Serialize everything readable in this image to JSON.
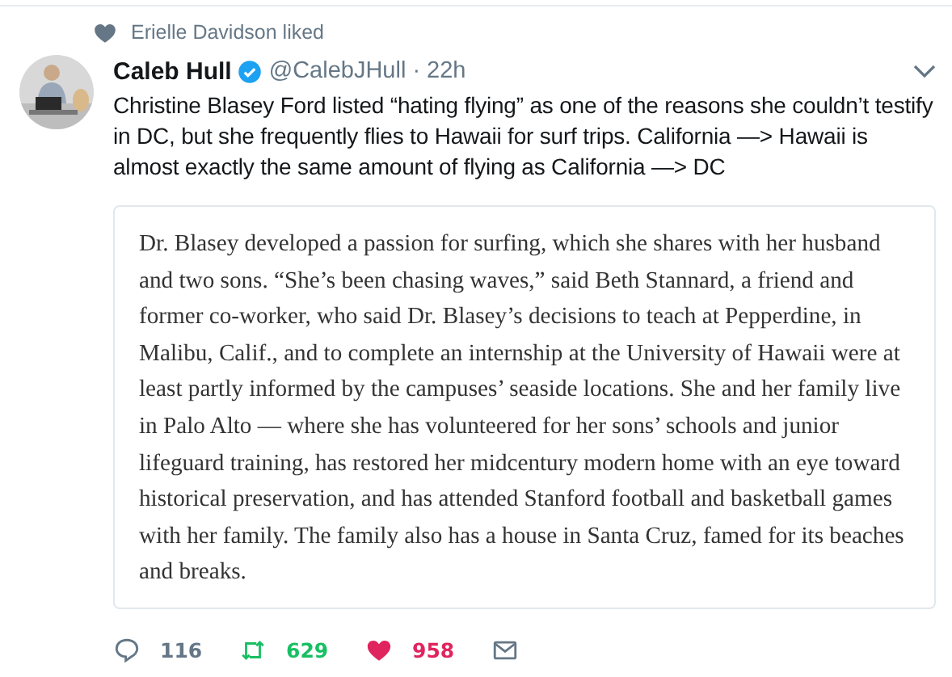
{
  "social_context": {
    "text": "Erielle Davidson liked"
  },
  "tweet": {
    "author": {
      "name": "Caleb Hull",
      "verified": true,
      "handle": "@CalebJHull",
      "separator": "·",
      "time": "22h"
    },
    "text": "Christine Blasey Ford listed “hating flying” as one of the reasons she couldn’t testify in DC, but she frequently flies to Hawaii for surf trips. California —> Hawaii is almost exactly the same amount of flying as California —> DC",
    "quote": {
      "text": "Dr. Blasey developed a passion for surfing, which she shares with her husband and two sons. “She’s been chasing waves,” said Beth Stannard, a friend and former co-worker, who said Dr. Blasey’s decisions to teach at Pepperdine, in Malibu, Calif., and to complete an internship at the University of Hawaii were at least partly informed by the campuses’ seaside locations. She and her family live in Palo Alto — where she has volunteered for her sons’ schools and junior lifeguard training, has restored her midcentury modern home with an eye toward historical preservation, and has attended Stanford football and basketball games with her family. The family also has a house in Santa Cruz, famed for its beaches and breaks."
    },
    "actions": [
      {
        "kind": "reply",
        "count": "116",
        "selected": false
      },
      {
        "kind": "retweet",
        "count": "629",
        "selected": true
      },
      {
        "kind": "like",
        "count": "958",
        "selected": true
      },
      {
        "kind": "message",
        "selected": false
      }
    ]
  }
}
